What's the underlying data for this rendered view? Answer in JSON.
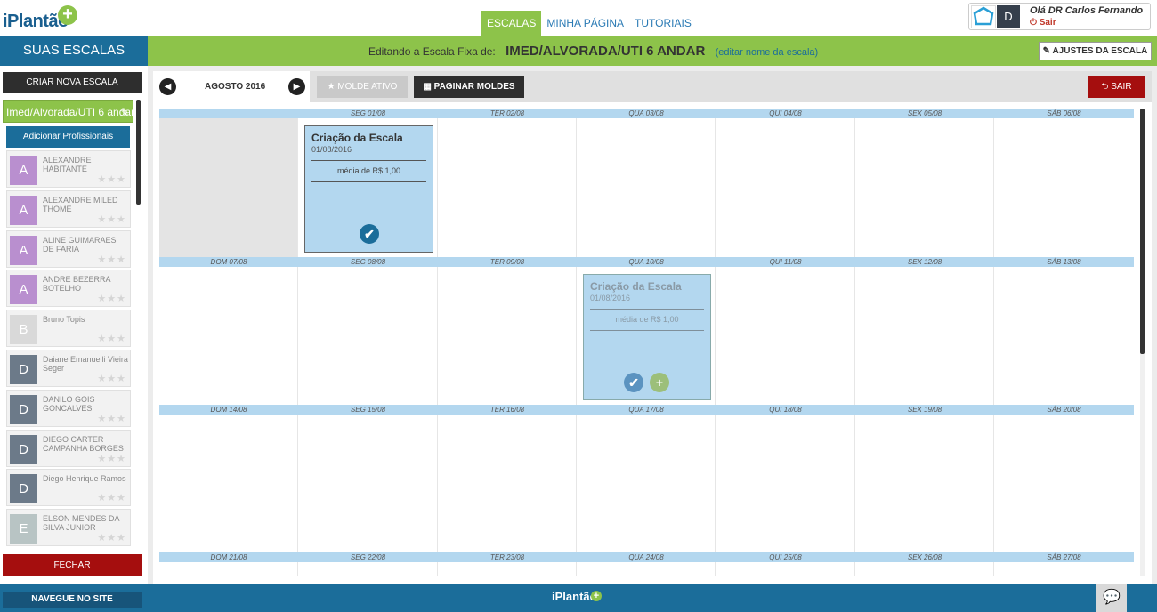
{
  "brand": {
    "logo_text": "iPlantão",
    "logo_mark": "+",
    "footer_logo": "iPlantão"
  },
  "nav": {
    "items": [
      "ESCALAS",
      "MINHA PÁGINA",
      "TUTORIAIS"
    ],
    "active": "ESCALAS"
  },
  "user": {
    "greeting": "Olá DR Carlos Fernando",
    "initial": "D",
    "logout": "Sair"
  },
  "header": {
    "section_title": "SUAS ESCALAS",
    "editing_label": "Editando a Escala Fixa de:",
    "scale_name": "IMED/ALVORADA/UTI 6 ANDAR",
    "edit_link": "(editar nome da escala)",
    "settings_button": "AJUSTES DA ESCALA"
  },
  "sidebar": {
    "create_button": "CRIAR NOVA ESCALA",
    "current_scale": "Imed/Alvorada/UTI 6 andar",
    "add_button": "Adicionar Profissionais",
    "close_button": "FECHAR",
    "professionals": [
      {
        "initial": "A",
        "name": "ALEXANDRE HABITANTE",
        "color": "#b98fcf"
      },
      {
        "initial": "A",
        "name": "ALEXANDRE MILED THOME",
        "color": "#b98fcf"
      },
      {
        "initial": "A",
        "name": "ALINE GUIMARAES DE FARIA",
        "color": "#b98fcf"
      },
      {
        "initial": "A",
        "name": "ANDRE BEZERRA BOTELHO",
        "color": "#b98fcf"
      },
      {
        "initial": "B",
        "name": "Bruno Topis",
        "color": "#d9d9d9"
      },
      {
        "initial": "D",
        "name": "Daiane Emanuelli Vieira Seger",
        "color": "#6c7a89"
      },
      {
        "initial": "D",
        "name": "DANILO GOIS GONCALVES",
        "color": "#6c7a89"
      },
      {
        "initial": "D",
        "name": "DIEGO CARTER CAMPANHA BORGES",
        "color": "#6c7a89"
      },
      {
        "initial": "D",
        "name": "Diego Henrique Ramos",
        "color": "#6c7a89"
      },
      {
        "initial": "E",
        "name": "ELSON MENDES DA SILVA JUNIOR",
        "color": "#b8c4c4"
      }
    ]
  },
  "toolbar": {
    "month": "AGOSTO 2016",
    "active_template": "MOLDE ATIVO",
    "paginate": "PAGINAR MOLDES",
    "exit": "SAIR"
  },
  "calendar": {
    "weeks": [
      [
        "",
        "SEG 01/08",
        "TER 02/08",
        "QUA 03/08",
        "QUI 04/08",
        "SEX 05/08",
        "SÁB 06/08"
      ],
      [
        "DOM 07/08",
        "SEG 08/08",
        "TER 09/08",
        "QUA 10/08",
        "QUI 11/08",
        "SEX 12/08",
        "SÁB 13/08"
      ],
      [
        "DOM 14/08",
        "SEG 15/08",
        "TER 16/08",
        "QUA 17/08",
        "QUI 18/08",
        "SEX 19/08",
        "SÁB 20/08"
      ],
      [
        "DOM 21/08",
        "SEG 22/08",
        "TER 23/08",
        "QUA 24/08",
        "QUI 25/08",
        "SEX 26/08",
        "SÁB 27/08"
      ]
    ],
    "shift_cards": [
      {
        "title": "Criação da Escala",
        "date": "01/08/2016",
        "avg": "média de R$ 1,00",
        "style": "solid"
      },
      {
        "title": "Criação da Escala",
        "date": "01/08/2016",
        "avg": "média de R$ 1,00",
        "style": "faded"
      }
    ]
  },
  "footer": {
    "nav_button": "NAVEGUE NO SITE"
  },
  "icons": [
    "logo-plus-icon",
    "user-badge-icon",
    "power-icon",
    "pencil-icon",
    "chevron-left-icon",
    "chevron-right-icon",
    "star-icon",
    "grid-icon",
    "reply-arrow-icon",
    "check-circle-icon",
    "plus-circle-icon",
    "chat-icon"
  ]
}
